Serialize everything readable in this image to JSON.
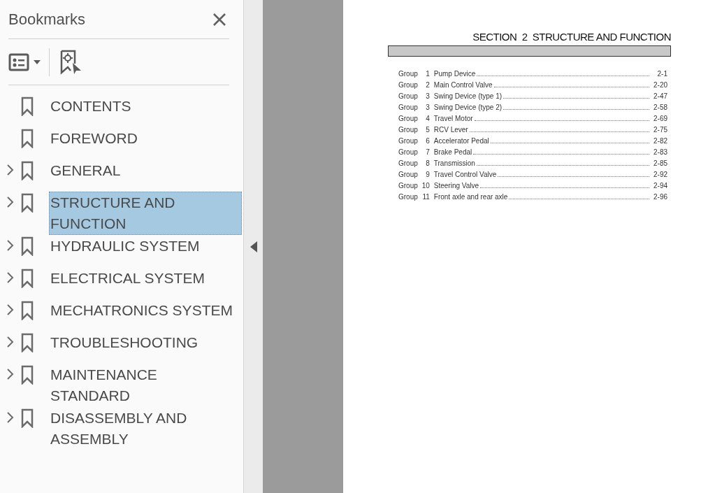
{
  "panel": {
    "title": "Bookmarks"
  },
  "bookmarks": [
    {
      "label": "CONTENTS",
      "expandable": false,
      "selected": false
    },
    {
      "label": "FOREWORD",
      "expandable": false,
      "selected": false
    },
    {
      "label": "GENERAL",
      "expandable": true,
      "selected": false
    },
    {
      "label": "STRUCTURE AND FUNCTION",
      "expandable": true,
      "selected": true
    },
    {
      "label": "HYDRAULIC SYSTEM",
      "expandable": true,
      "selected": false
    },
    {
      "label": "ELECTRICAL SYSTEM",
      "expandable": true,
      "selected": false
    },
    {
      "label": "MECHATRONICS SYSTEM",
      "expandable": true,
      "selected": false
    },
    {
      "label": "TROUBLESHOOTING",
      "expandable": true,
      "selected": false
    },
    {
      "label": "MAINTENANCE STANDARD",
      "expandable": true,
      "selected": false
    },
    {
      "label": "DISASSEMBLY AND ASSEMBLY",
      "expandable": true,
      "selected": false
    }
  ],
  "document": {
    "section_title": "SECTION  2  STRUCTURE AND FUNCTION",
    "toc": [
      {
        "group": "Group",
        "number": "1",
        "title": "Pump Device",
        "page": "2-1"
      },
      {
        "group": "Group",
        "number": "2",
        "title": "Main Control Valve",
        "page": "2-20"
      },
      {
        "group": "Group",
        "number": "3",
        "title": "Swing Device (type 1)",
        "page": "2-47"
      },
      {
        "group": "Group",
        "number": "3",
        "title": "Swing Device (type 2)",
        "page": "2-58"
      },
      {
        "group": "Group",
        "number": "4",
        "title": "Travel Motor",
        "page": "2-69"
      },
      {
        "group": "Group",
        "number": "5",
        "title": "RCV Lever",
        "page": "2-75"
      },
      {
        "group": "Group",
        "number": "6",
        "title": "Accelerator Pedal",
        "page": "2-82"
      },
      {
        "group": "Group",
        "number": "7",
        "title": "Brake Pedal",
        "page": "2-83"
      },
      {
        "group": "Group",
        "number": "8",
        "title": "Transmission",
        "page": "2-85"
      },
      {
        "group": "Group",
        "number": "9",
        "title": "Travel Control Valve",
        "page": "2-92"
      },
      {
        "group": "Group",
        "number": "10",
        "title": "Steering Valve",
        "page": "2-94"
      },
      {
        "group": "Group",
        "number": "11",
        "title": "Front axle and rear axle",
        "page": "2-96"
      }
    ]
  }
}
